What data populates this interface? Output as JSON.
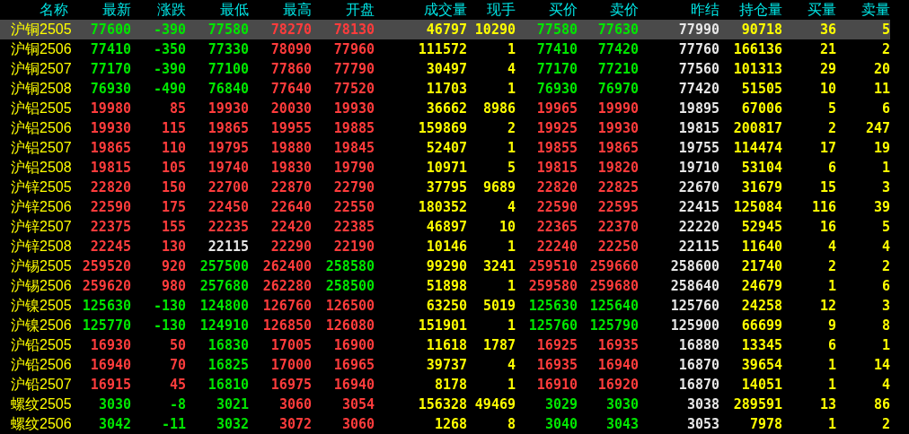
{
  "table": {
    "columns": [
      "名称",
      "最新",
      "涨跌",
      "最低",
      "最高",
      "开盘",
      "成交量",
      "现手",
      "买价",
      "卖价",
      "昨结",
      "持仓量",
      "买量",
      "卖量"
    ],
    "rows": [
      {
        "selected": true,
        "cells": [
          "沪铜2505",
          "77600",
          "-390",
          "77580",
          "78270",
          "78130",
          "46797",
          "10290",
          "77580",
          "77630",
          "77990",
          "90718",
          "36",
          "5"
        ]
      },
      {
        "selected": false,
        "cells": [
          "沪铜2506",
          "77410",
          "-350",
          "77330",
          "78090",
          "77960",
          "111572",
          "1",
          "77410",
          "77420",
          "77760",
          "166136",
          "21",
          "2"
        ]
      },
      {
        "selected": false,
        "cells": [
          "沪铜2507",
          "77170",
          "-390",
          "77100",
          "77860",
          "77790",
          "30497",
          "4",
          "77170",
          "77210",
          "77560",
          "101313",
          "29",
          "20"
        ]
      },
      {
        "selected": false,
        "cells": [
          "沪铜2508",
          "76930",
          "-490",
          "76840",
          "77640",
          "77520",
          "11703",
          "1",
          "76930",
          "76970",
          "77420",
          "51505",
          "10",
          "11"
        ]
      },
      {
        "selected": false,
        "cells": [
          "沪铝2505",
          "19980",
          "85",
          "19930",
          "20030",
          "19930",
          "36662",
          "8986",
          "19965",
          "19990",
          "19895",
          "67006",
          "5",
          "6"
        ]
      },
      {
        "selected": false,
        "cells": [
          "沪铝2506",
          "19930",
          "115",
          "19865",
          "19955",
          "19885",
          "159869",
          "2",
          "19925",
          "19930",
          "19815",
          "200817",
          "2",
          "247"
        ]
      },
      {
        "selected": false,
        "cells": [
          "沪铝2507",
          "19865",
          "110",
          "19795",
          "19880",
          "19845",
          "52407",
          "1",
          "19855",
          "19865",
          "19755",
          "114474",
          "17",
          "19"
        ]
      },
      {
        "selected": false,
        "cells": [
          "沪铝2508",
          "19815",
          "105",
          "19740",
          "19830",
          "19790",
          "10971",
          "5",
          "19815",
          "19820",
          "19710",
          "53104",
          "6",
          "1"
        ]
      },
      {
        "selected": false,
        "cells": [
          "沪锌2505",
          "22820",
          "150",
          "22700",
          "22870",
          "22790",
          "37795",
          "9689",
          "22820",
          "22825",
          "22670",
          "31679",
          "15",
          "3"
        ]
      },
      {
        "selected": false,
        "cells": [
          "沪锌2506",
          "22590",
          "175",
          "22450",
          "22640",
          "22550",
          "180352",
          "4",
          "22590",
          "22595",
          "22415",
          "125084",
          "116",
          "39"
        ]
      },
      {
        "selected": false,
        "cells": [
          "沪锌2507",
          "22375",
          "155",
          "22235",
          "22420",
          "22385",
          "46897",
          "10",
          "22365",
          "22370",
          "22220",
          "52945",
          "16",
          "5"
        ]
      },
      {
        "selected": false,
        "cells": [
          "沪锌2508",
          "22245",
          "130",
          "22115",
          "22290",
          "22190",
          "10146",
          "1",
          "22240",
          "22250",
          "22115",
          "11640",
          "4",
          "4"
        ]
      },
      {
        "selected": false,
        "cells": [
          "沪锡2505",
          "259520",
          "920",
          "257500",
          "262400",
          "258580",
          "99290",
          "3241",
          "259510",
          "259660",
          "258600",
          "21740",
          "2",
          "2"
        ]
      },
      {
        "selected": false,
        "cells": [
          "沪锡2506",
          "259620",
          "980",
          "257680",
          "262280",
          "258500",
          "51898",
          "1",
          "259580",
          "259680",
          "258640",
          "24679",
          "1",
          "6"
        ]
      },
      {
        "selected": false,
        "cells": [
          "沪镍2505",
          "125630",
          "-130",
          "124800",
          "126760",
          "126500",
          "63250",
          "5019",
          "125630",
          "125640",
          "125760",
          "24258",
          "12",
          "3"
        ]
      },
      {
        "selected": false,
        "cells": [
          "沪镍2506",
          "125770",
          "-130",
          "124910",
          "126850",
          "126080",
          "151901",
          "1",
          "125760",
          "125790",
          "125900",
          "66699",
          "9",
          "8"
        ]
      },
      {
        "selected": false,
        "cells": [
          "沪铅2505",
          "16930",
          "50",
          "16830",
          "17005",
          "16900",
          "11618",
          "1787",
          "16925",
          "16935",
          "16880",
          "13345",
          "6",
          "1"
        ]
      },
      {
        "selected": false,
        "cells": [
          "沪铅2506",
          "16940",
          "70",
          "16825",
          "17000",
          "16965",
          "39737",
          "4",
          "16935",
          "16940",
          "16870",
          "39654",
          "1",
          "14"
        ]
      },
      {
        "selected": false,
        "cells": [
          "沪铅2507",
          "16915",
          "45",
          "16810",
          "16975",
          "16940",
          "8178",
          "1",
          "16910",
          "16920",
          "16870",
          "14051",
          "1",
          "4"
        ]
      },
      {
        "selected": false,
        "cells": [
          "螺纹2505",
          "3030",
          "-8",
          "3021",
          "3060",
          "3054",
          "156328",
          "49469",
          "3029",
          "3030",
          "3038",
          "289591",
          "13",
          "86"
        ]
      },
      {
        "selected": false,
        "cells": [
          "螺纹2506",
          "3042",
          "-11",
          "3032",
          "3072",
          "3060",
          "1268",
          "8",
          "3040",
          "3043",
          "3053",
          "7978",
          "1",
          "2"
        ]
      }
    ]
  }
}
